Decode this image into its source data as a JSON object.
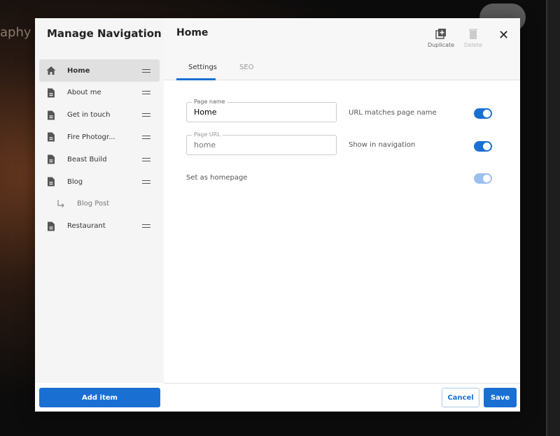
{
  "background": {
    "site_title_fragment": "aphy"
  },
  "sidebar": {
    "title": "Manage Navigation",
    "items": [
      {
        "label": "Home",
        "icon": "home-icon",
        "active": true
      },
      {
        "label": "About me",
        "icon": "page-icon"
      },
      {
        "label": "Get in touch",
        "icon": "page-icon"
      },
      {
        "label": "Fire Photogr...",
        "icon": "page-icon"
      },
      {
        "label": "Beast Build",
        "icon": "page-icon"
      },
      {
        "label": "Blog",
        "icon": "page-icon"
      },
      {
        "label": "Blog Post",
        "icon": "subpage-arrow-icon",
        "child": true
      },
      {
        "label": "Restaurant",
        "icon": "page-icon"
      }
    ],
    "add_label": "Add item"
  },
  "main": {
    "title": "Home",
    "duplicate_label": "Duplicate",
    "delete_label": "Delete",
    "tabs": [
      {
        "label": "Settings",
        "active": true
      },
      {
        "label": "SEO"
      }
    ],
    "page_name_label": "Page name",
    "page_name_value": "Home",
    "page_url_label": "Page URL",
    "page_url_placeholder": "home",
    "url_matches_label": "URL matches page name",
    "url_matches_on": true,
    "show_nav_label": "Show in navigation",
    "show_nav_on": true,
    "homepage_label": "Set as homepage",
    "homepage_on": true,
    "homepage_disabled": true,
    "cancel_label": "Cancel",
    "save_label": "Save"
  },
  "colors": {
    "accent": "#1a6fd3"
  }
}
